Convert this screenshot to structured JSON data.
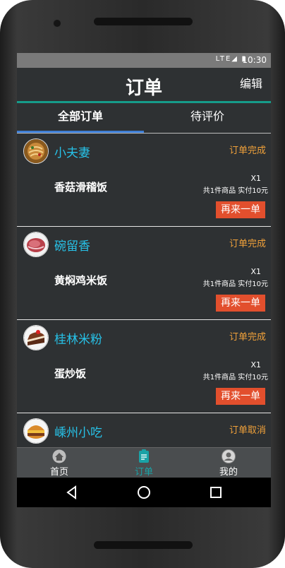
{
  "status_bar": {
    "time": "10:30",
    "network_label": "LTE"
  },
  "header": {
    "title": "订单",
    "edit_label": "编辑"
  },
  "tabs": [
    {
      "label": "全部订单",
      "active": true
    },
    {
      "label": "待评价",
      "active": false
    }
  ],
  "orders": [
    {
      "shop": "小夫妻",
      "status": "订单完成",
      "dish": "香菇滑稽饭",
      "qty": "X1",
      "summary": "共1件商品 实付10元",
      "again_label": "再来一单",
      "avatar_icon": "noodles-food-icon"
    },
    {
      "shop": "碗留香",
      "status": "订单完成",
      "dish": "黄焖鸡米饭",
      "qty": "X1",
      "summary": "共1件商品 实付10元",
      "again_label": "再来一单",
      "avatar_icon": "meat-food-icon"
    },
    {
      "shop": "桂林米粉",
      "status": "订单完成",
      "dish": "蛋炒饭",
      "qty": "X1",
      "summary": "共1件商品 实付10元",
      "again_label": "再来一单",
      "avatar_icon": "cake-food-icon"
    },
    {
      "shop": "嵊州小吃",
      "status": "订单取消",
      "avatar_icon": "burger-food-icon"
    }
  ],
  "bottom_nav": [
    {
      "label": "首页",
      "icon": "home-icon",
      "active": false
    },
    {
      "label": "订单",
      "icon": "clipboard-icon",
      "active": true
    },
    {
      "label": "我的",
      "icon": "user-icon",
      "active": false
    }
  ],
  "colors": {
    "accent_teal": "#169c8a",
    "shop_name": "#27c2e8",
    "status_orange": "#f0a13a",
    "reorder_button": "#e24f2d",
    "tab_indicator": "#3f7fd6",
    "background": "#2e3133"
  }
}
